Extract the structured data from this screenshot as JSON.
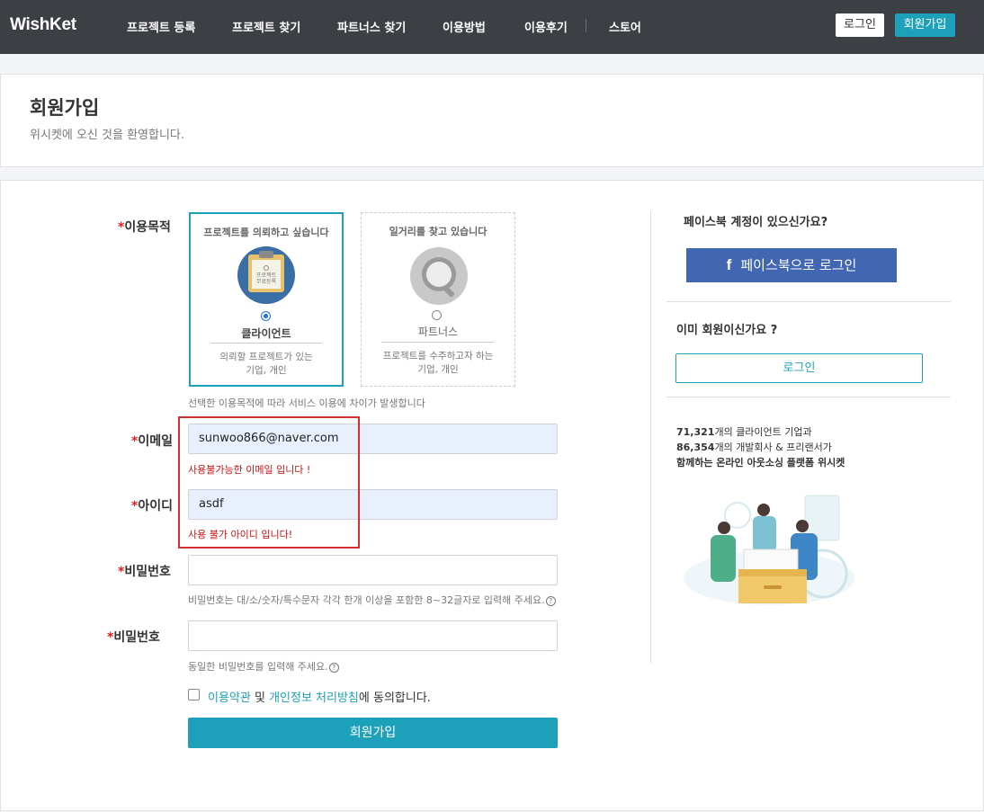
{
  "nav": {
    "logo": "WishKet",
    "items": [
      "프로젝트 등록",
      "프로젝트 찾기",
      "파트너스 찾기",
      "이용방법",
      "이용후기",
      "스토어"
    ],
    "login": "로그인",
    "signup": "회원가입"
  },
  "header": {
    "title": "회원가입",
    "subtitle": "위시켓에 오신 것을 환영합니다."
  },
  "form": {
    "purpose_label": "이용목적",
    "required_mark": "*",
    "client_card": {
      "top": "프로젝트를 의뢰하고 싶습니다",
      "badge_line1": "프로젝트",
      "badge_line2": "무료등록",
      "name": "클라이언트",
      "desc1": "의뢰할 프로젝트가 있는",
      "desc2": "기업, 개인",
      "selected": true
    },
    "partner_card": {
      "top": "일거리를 찾고 있습니다",
      "name": "파트너스",
      "desc1": "프로젝트를 수주하고자 하는",
      "desc2": "기업, 개인",
      "selected": false
    },
    "purpose_hint": "선택한 이용목적에 따라 서비스 이용에 차이가 발생합니다",
    "email_label": "이메일",
    "email_value": "sunwoo866@naver.com",
    "email_error": "사용불가능한 이메일 입니다 !",
    "id_label": "아이디",
    "id_value": "asdf",
    "id_error": "사용 불가 아이디 입니다!",
    "pw_label": "비밀번호",
    "pw_hint": "비밀번호는 대/소/숫자/특수문자 각각 한개 이상을 포함한 8~32글자로 입력해 주세요.",
    "pw2_label": "비밀번호",
    "pw2_hint": "동일한 비밀번호를 입력해 주세요.",
    "help_glyph": "?",
    "terms_link": "이용약관",
    "and_text": " 및 ",
    "privacy_link": "개인정보 처리방침",
    "agree_suffix": "에 동의합니다.",
    "submit": "회원가입"
  },
  "side": {
    "fb_question": "페이스북 계정이 있으신가요?",
    "fb_icon": "f",
    "fb_button": "페이스북으로 로그인",
    "member_question": "이미 회원이신가요 ?",
    "login_button": "로그인",
    "stat1_num": "71,321",
    "stat1_text": "개의 클라이언트 기업과",
    "stat2_num": "86,354",
    "stat2_text": "개의 개발회사 & 프리랜서가",
    "stat3_text": "함께하는 온라인 아웃소싱 플랫폼 위시켓"
  },
  "colors": {
    "nav_bg": "#3c3f44",
    "accent": "#1da1ba",
    "facebook": "#4267b2",
    "error": "#d01010"
  }
}
